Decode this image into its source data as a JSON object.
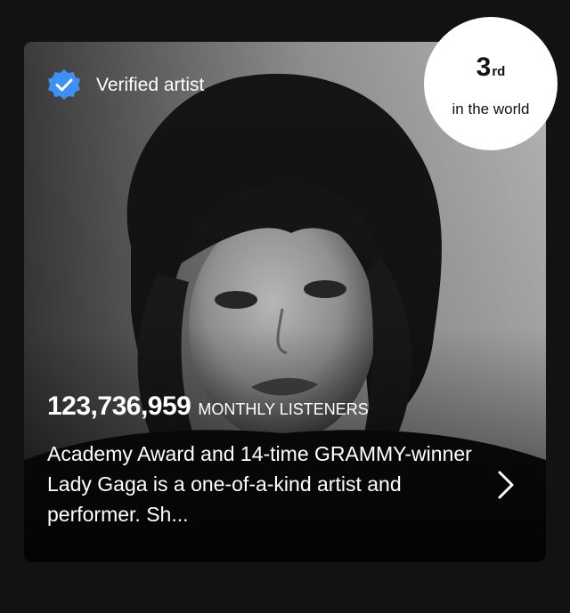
{
  "verified": {
    "label": "Verified artist",
    "icon": "verified-badge-icon",
    "badge_color": "#3d91f4"
  },
  "rank": {
    "number": "3",
    "suffix": "rd",
    "subtitle": "in the world"
  },
  "listeners": {
    "count": "123,736,959",
    "label": "MONTHLY LISTENERS"
  },
  "bio": {
    "text": "Academy Award and 14-time GRAMMY-winner Lady Gaga is a one-of-a-kind artist and performer. Sh..."
  },
  "more": {
    "icon": "chevron-right-icon"
  },
  "colors": {
    "page_background": "#121212",
    "rank_circle": "#ffffff",
    "text": "#ffffff"
  }
}
